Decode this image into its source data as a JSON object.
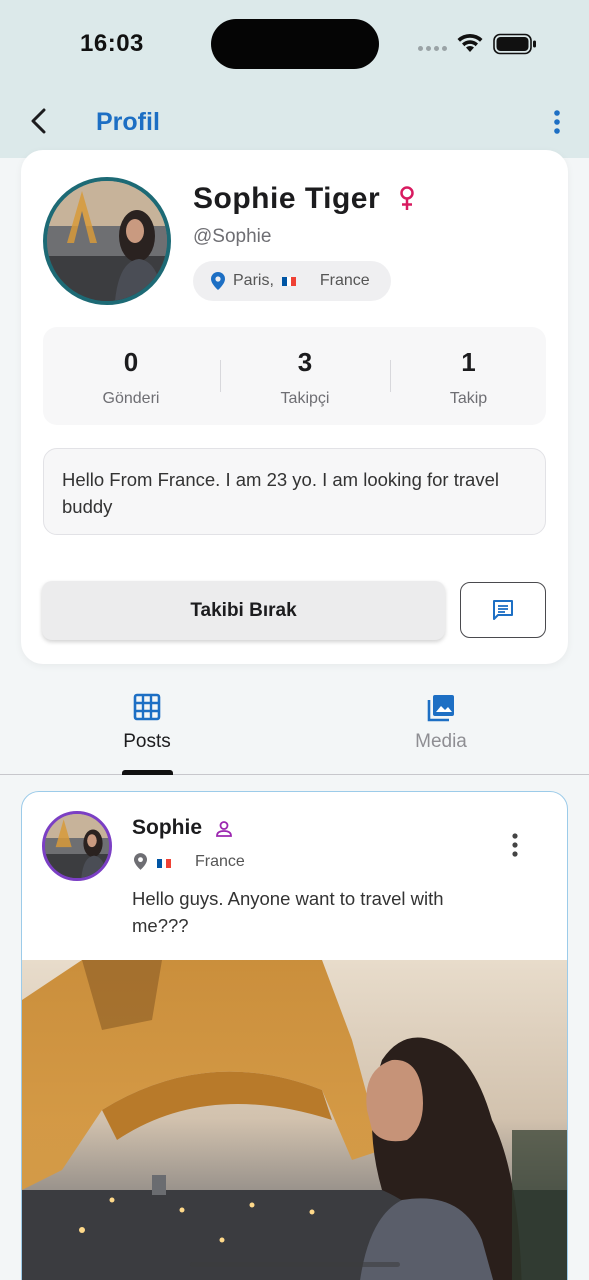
{
  "status_bar": {
    "time": "16:03",
    "icons": [
      "signal-dots-icon",
      "wifi-icon",
      "battery-icon"
    ]
  },
  "app_bar": {
    "title": "Profil",
    "back_icon": "chevron-left-icon",
    "more_icon": "more-vertical-icon"
  },
  "profile": {
    "name": "Sophie Tiger",
    "gender_icon": "female-icon",
    "username": "@Sophie",
    "location": {
      "city": "Paris,",
      "country": "France",
      "flag": "flag-france-icon"
    },
    "stats": [
      {
        "value": "0",
        "label": "Gönderi"
      },
      {
        "value": "3",
        "label": "Takipçi"
      },
      {
        "value": "1",
        "label": "Takip"
      }
    ],
    "bio": "Hello From France. I am 23 yo. I am looking for travel buddy",
    "unfollow_label": "Takibi Bırak",
    "message_icon": "message-icon"
  },
  "tabs": [
    {
      "label": "Posts",
      "icon": "grid-icon",
      "active": true
    },
    {
      "label": "Media",
      "icon": "image-icon",
      "active": false
    }
  ],
  "post": {
    "author": "Sophie",
    "author_icon": "person-icon",
    "country": "France",
    "text": "Hello guys.  Anyone want to travel with me???",
    "image": "eiffel-tower-photo"
  },
  "colors": {
    "accent": "#1d6fc4",
    "header_bg": "#dce9ea",
    "female_icon": "#d81b60",
    "post_border": "#9ccbe9",
    "avatar_ring": "#1d6a75",
    "post_avatar_ring": "#7b3fc4",
    "person_icon": "#9c27b0"
  }
}
